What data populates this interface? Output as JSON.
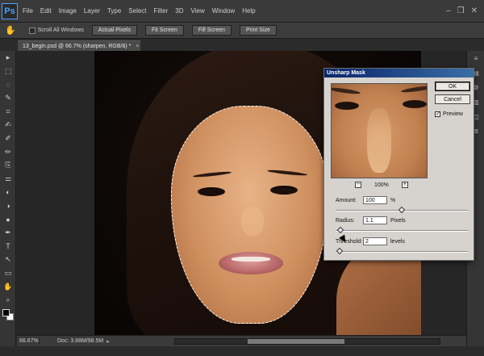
{
  "app": {
    "logo": "Ps"
  },
  "menu": [
    "File",
    "Edit",
    "Image",
    "Layer",
    "Type",
    "Select",
    "Filter",
    "3D",
    "View",
    "Window",
    "Help"
  ],
  "window_controls": [
    "–",
    "❐",
    "✕"
  ],
  "options_bar": {
    "tool_glyph": "✋",
    "scroll_all_windows": "Scroll All Windows",
    "scroll_all_windows_checked": false,
    "buttons": [
      "Actual Pixels",
      "Fit Screen",
      "Fill Screen",
      "Print Size"
    ]
  },
  "document_tab": {
    "title": "13_begin.psd @ 66.7% (sharpen, RGB/8) *",
    "close": "×"
  },
  "tools": [
    "▸",
    "⬚",
    "◌",
    "✎",
    "⌗",
    "✍",
    "✐",
    "✏",
    "⎘",
    "⚌",
    "◐",
    "◑",
    "●",
    "✒",
    "T",
    "↖",
    "▭",
    "✋",
    "⌕"
  ],
  "right_panel_icons": [
    "≡",
    "▤",
    "⚙",
    "▥",
    "◫",
    "≣"
  ],
  "status": {
    "zoom": "66.67%",
    "doc": "Doc: 3.88M/98.5M",
    "arrow": "▸"
  },
  "dialog": {
    "title": "Unsharp Mask",
    "ok": "OK",
    "cancel": "Cancel",
    "preview_label": "Preview",
    "preview_checked": true,
    "preview_zoom": "100%",
    "zoom_out": "−",
    "zoom_in": "+",
    "amount": {
      "label": "Amount:",
      "value": "100",
      "unit": "%",
      "slider_fraction": 0.5
    },
    "radius": {
      "label": "Radius:",
      "value": "1.1",
      "unit": "Pixels",
      "slider_fraction": 0.02
    },
    "threshold": {
      "label": "Threshold:",
      "value": "2",
      "unit": "levels",
      "slider_fraction": 0.01
    }
  },
  "colors": {
    "accent": "#4aa3ff",
    "dialog_bg": "#d6d3ce",
    "title_bar": "#0a246a"
  }
}
